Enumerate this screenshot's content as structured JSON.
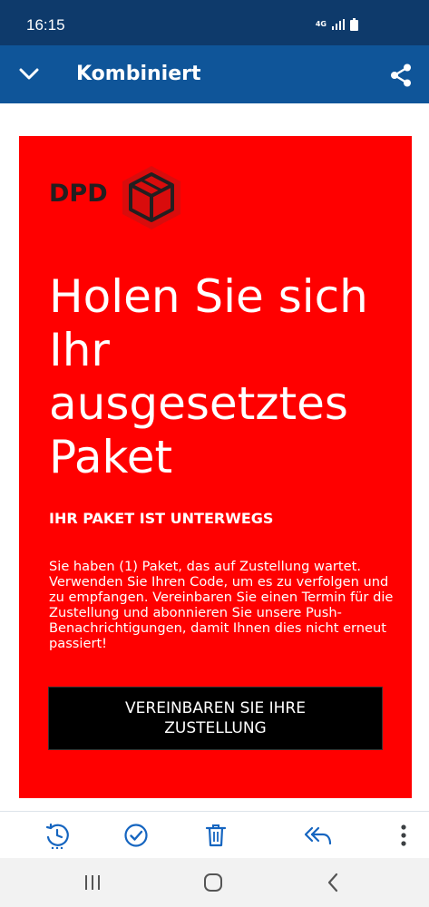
{
  "status_bar": {
    "time": "16:15",
    "network": "4G"
  },
  "app_bar": {
    "title": "Kombiniert"
  },
  "email": {
    "logo_text": "DPD",
    "headline": "Holen Sie sich Ihr ausgesetztes Paket",
    "subheadline": "IHR PAKET IST UNTERWEGS",
    "body": "Sie haben (1) Paket, das auf Zustellung wartet. Verwenden Sie Ihren Code, um es zu verfolgen und zu empfangen. Vereinbaren Sie einen Termin für die Zustellung und abonnieren Sie unsere Push-Benachrichtigungen, damit Ihnen dies nicht erneut passiert!",
    "cta_label": "VEREINBAREN SIE IHRE ZUSTELLUNG"
  },
  "toolbar": {
    "icons": [
      "snooze-icon",
      "check-circle-icon",
      "trash-icon",
      "reply-all-icon",
      "more-vertical-icon"
    ]
  },
  "navigation": {
    "icons": [
      "recent-apps-icon",
      "home-icon",
      "back-icon"
    ]
  },
  "colors": {
    "status_bar": "#0e3a6b",
    "app_bar": "#0f5599",
    "card_red": "#ff0000",
    "cta_black": "#000000",
    "toolbar_icon": "#1565c0"
  }
}
